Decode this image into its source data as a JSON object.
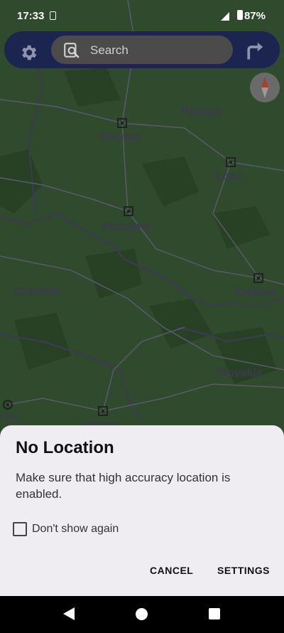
{
  "status_bar": {
    "time": "17:33",
    "battery_percent": "87%"
  },
  "map": {
    "places": {
      "poland": "Poland",
      "poznan": "Poznan",
      "lodz": "Łódź",
      "wroclaw": "Wrocław",
      "czechia": "Czechia",
      "krakow": "Krakow",
      "slovakia": "Slovakia",
      "linz": "Linz",
      "vienna": "Vienna"
    },
    "colors": {
      "land": "#2f4a2c",
      "forest": "#284024",
      "border": "#3b3b52",
      "road": "#5a5a6a"
    }
  },
  "toolbar": {
    "search_placeholder": "Search",
    "icons": [
      "gear-icon",
      "search-icon",
      "turn-right-icon",
      "compass-icon"
    ]
  },
  "dialog": {
    "title": "No Location",
    "message": "Make sure that high accuracy location is enabled.",
    "checkbox_label": "Don't show again",
    "cancel_label": "CANCEL",
    "settings_label": "SETTINGS"
  },
  "nav_bar": {
    "icons": [
      "back-icon",
      "home-icon",
      "recents-icon"
    ]
  }
}
